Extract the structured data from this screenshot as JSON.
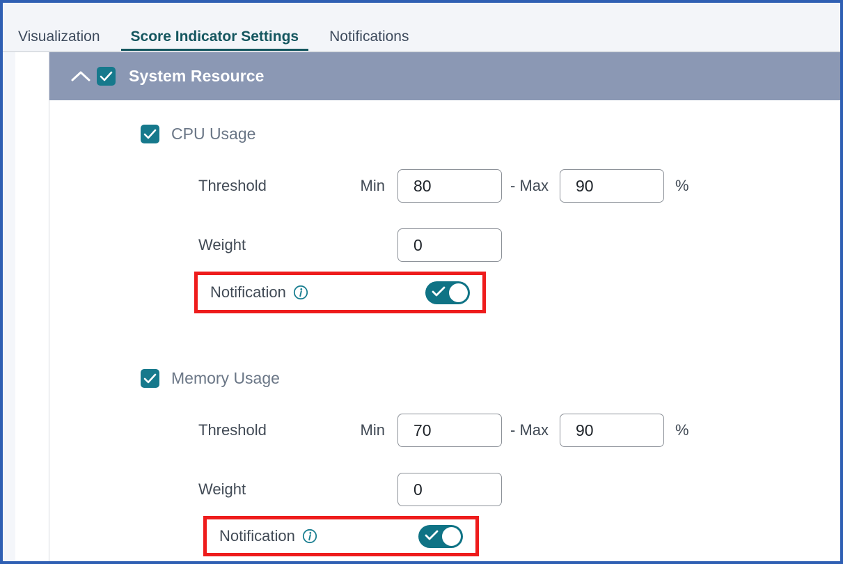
{
  "tabs": [
    {
      "label": "Visualization",
      "active": false
    },
    {
      "label": "Score Indicator Settings",
      "active": true
    },
    {
      "label": "Notifications",
      "active": false
    }
  ],
  "group": {
    "title": "System Resource",
    "checked": true,
    "expanded": true,
    "collapse_icon": "chevron-up-icon"
  },
  "indicators": [
    {
      "name": "CPU Usage",
      "checked": true,
      "threshold_label": "Threshold",
      "min_label": "Min",
      "separator": "- Max",
      "min_value": "80",
      "max_value": "90",
      "unit": "%",
      "weight_label": "Weight",
      "weight_value": "0",
      "notification_label": "Notification",
      "notification_info_icon": "info-circle-icon",
      "notification_enabled": true
    },
    {
      "name": "Memory Usage",
      "checked": true,
      "threshold_label": "Threshold",
      "min_label": "Min",
      "separator": "- Max",
      "min_value": "70",
      "max_value": "90",
      "unit": "%",
      "weight_label": "Weight",
      "weight_value": "0",
      "notification_label": "Notification",
      "notification_info_icon": "info-circle-icon",
      "notification_enabled": true
    }
  ],
  "colors": {
    "accent_teal": "#0f7385",
    "header_bar": "#8b98b4",
    "highlight_red": "#ee1c1c",
    "page_border_blue": "#2f5fb3",
    "active_tab": "#14565f"
  }
}
